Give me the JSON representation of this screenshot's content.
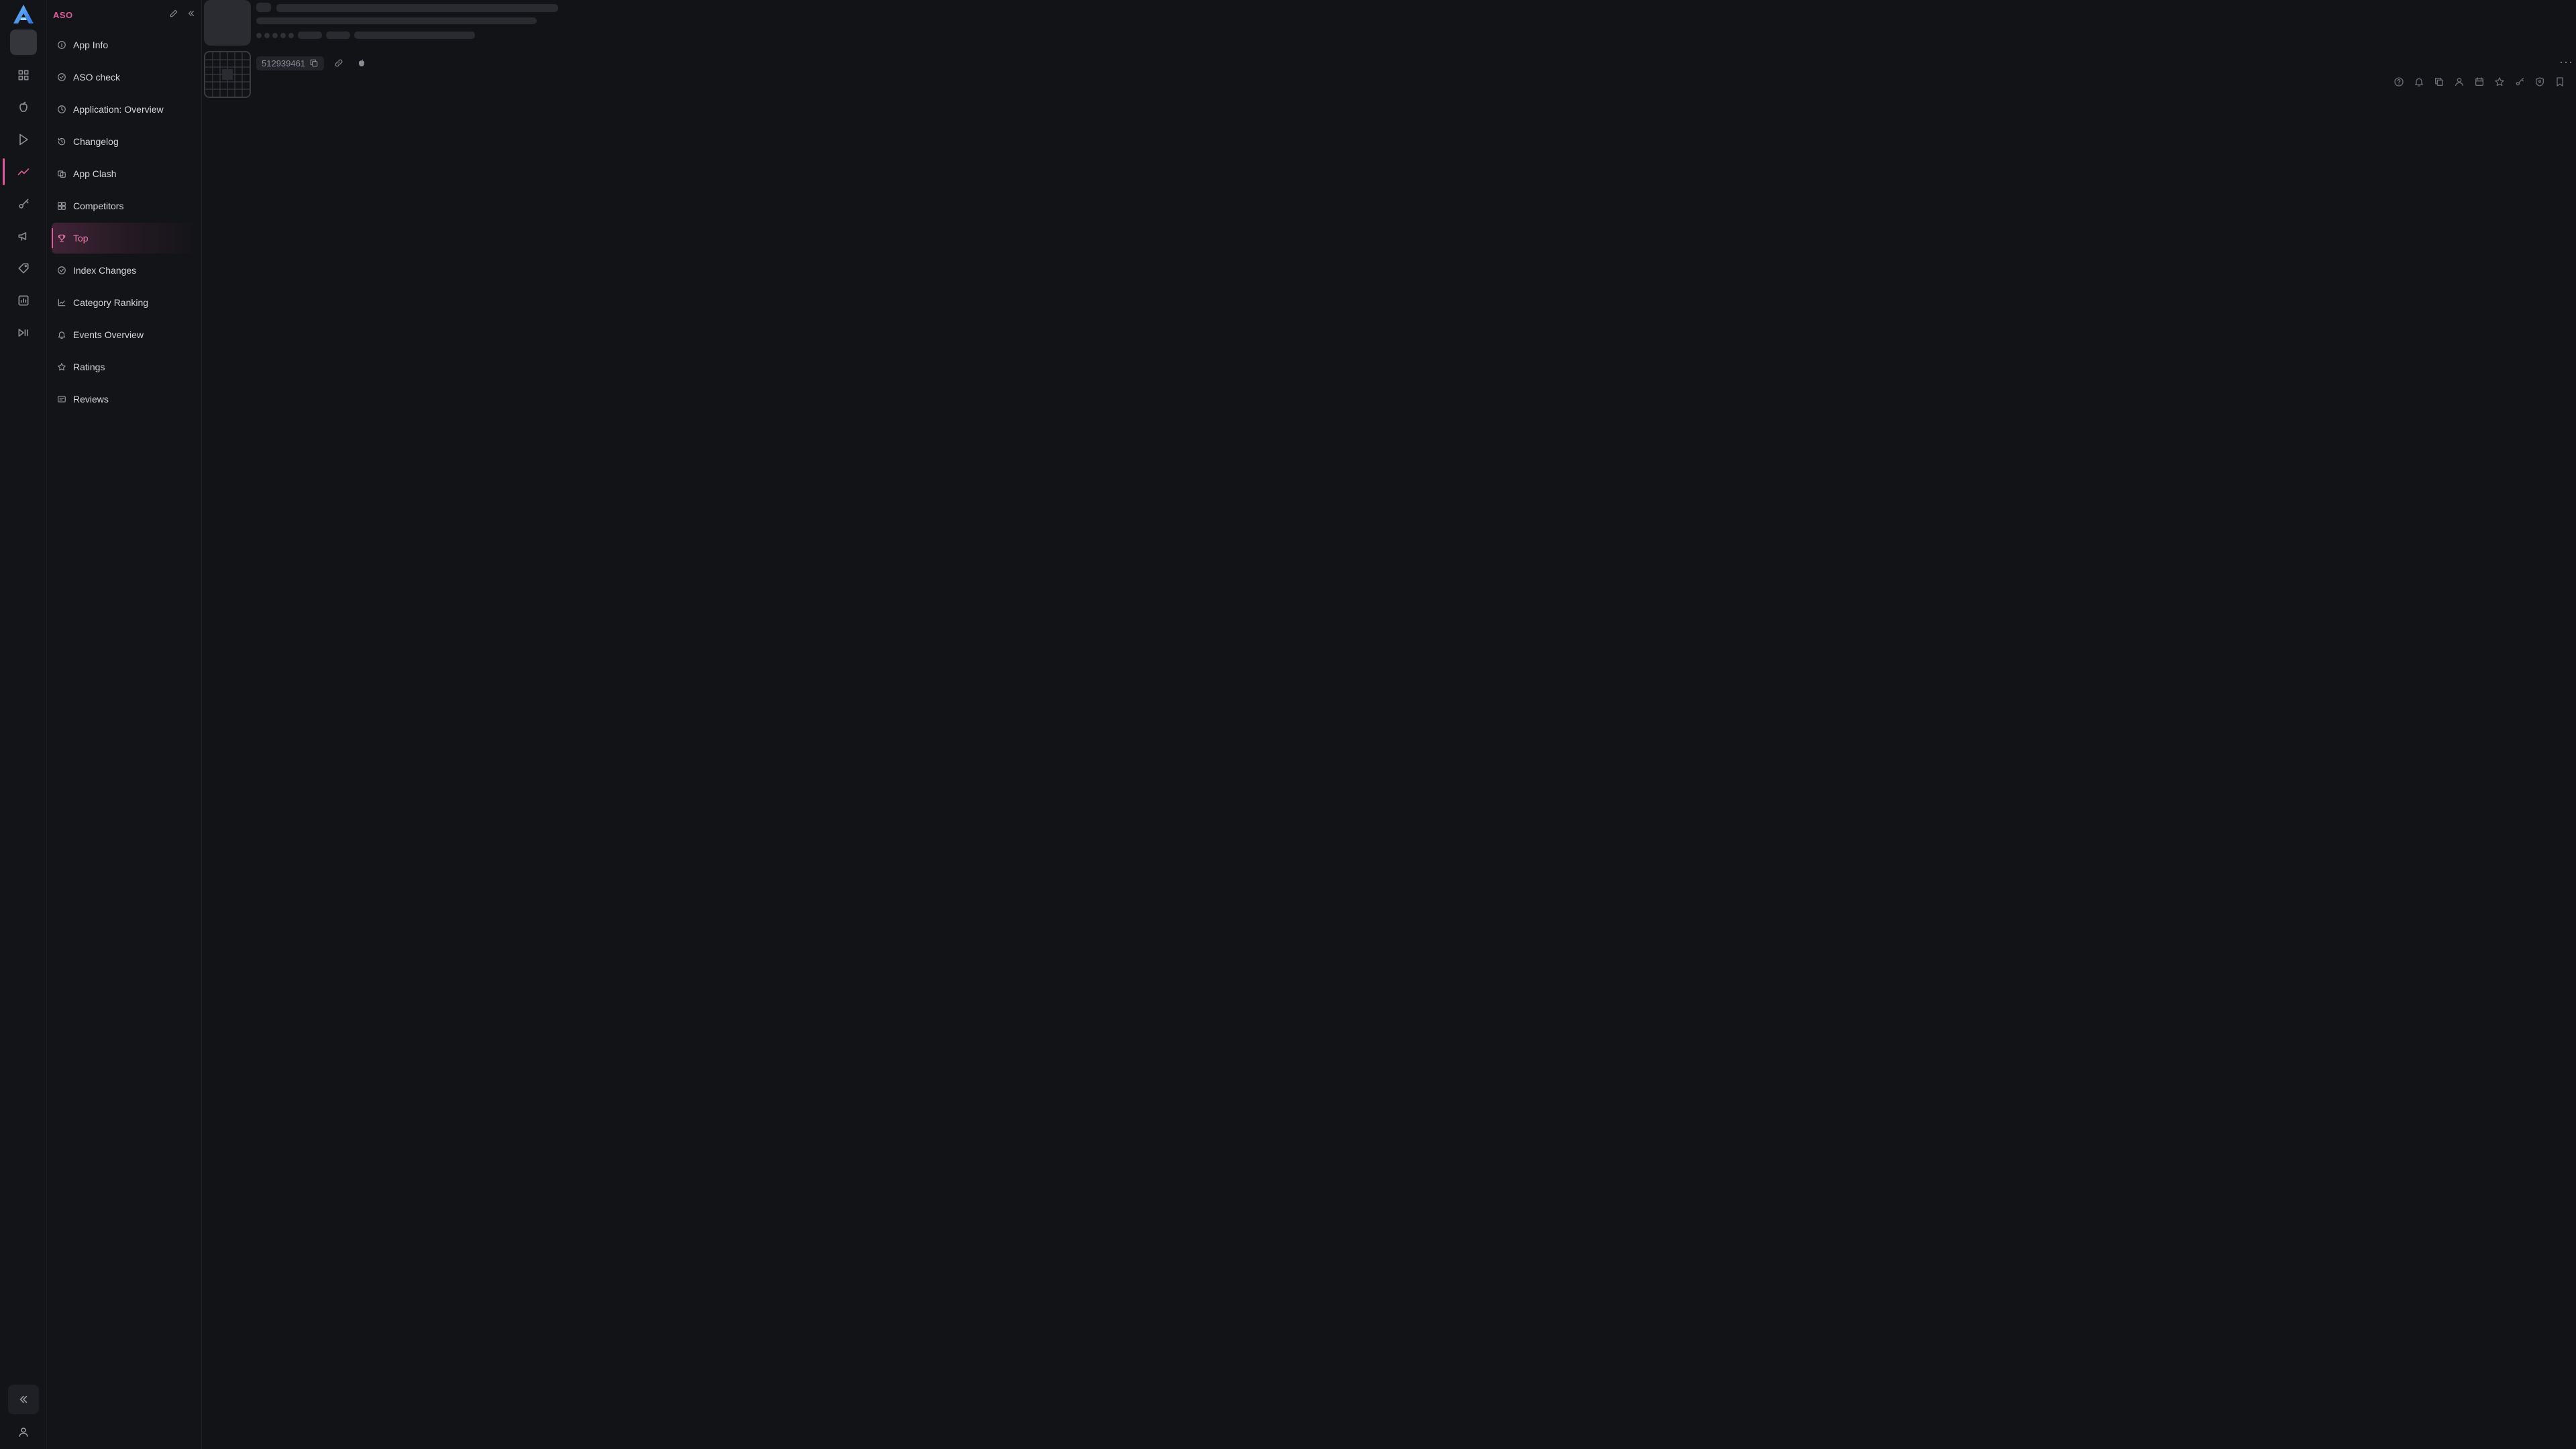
{
  "app": {
    "section_title": "ASO",
    "logo_icon": "app-logo-icon",
    "accent_color": "#e05a9c"
  },
  "rail": {
    "items": [
      {
        "name": "dashboard-icon"
      },
      {
        "name": "apple-store-icon"
      },
      {
        "name": "google-play-icon"
      },
      {
        "name": "aso-analytics-icon",
        "active": true
      },
      {
        "name": "keywords-icon"
      },
      {
        "name": "campaign-icon"
      },
      {
        "name": "tags-icon"
      },
      {
        "name": "reports-icon"
      },
      {
        "name": "integrations-icon"
      }
    ]
  },
  "sidebar": {
    "items": [
      {
        "label": "App Info",
        "icon": "info-icon"
      },
      {
        "label": "ASO check",
        "icon": "check-circle-icon"
      },
      {
        "label": "Application: Overview",
        "icon": "clock-icon"
      },
      {
        "label": "Changelog",
        "icon": "history-icon"
      },
      {
        "label": "App Clash",
        "icon": "clash-icon"
      },
      {
        "label": "Competitors",
        "icon": "competitors-icon"
      },
      {
        "label": "Top",
        "icon": "trophy-icon",
        "active": true
      },
      {
        "label": "Index Changes",
        "icon": "index-icon"
      },
      {
        "label": "Category Ranking",
        "icon": "chart-icon"
      },
      {
        "label": "Events Overview",
        "icon": "bell-icon"
      },
      {
        "label": "Ratings",
        "icon": "star-icon"
      },
      {
        "label": "Reviews",
        "icon": "reviews-icon"
      }
    ]
  },
  "app_header": {
    "app_id": "512939461",
    "platform_icon": "apple-icon"
  },
  "toolbar": {
    "icons": [
      "help-icon",
      "notification-icon",
      "copy-icon",
      "user-icon",
      "calendar-icon",
      "star-icon",
      "key-icon",
      "shield-icon",
      "bookmark-icon"
    ]
  }
}
